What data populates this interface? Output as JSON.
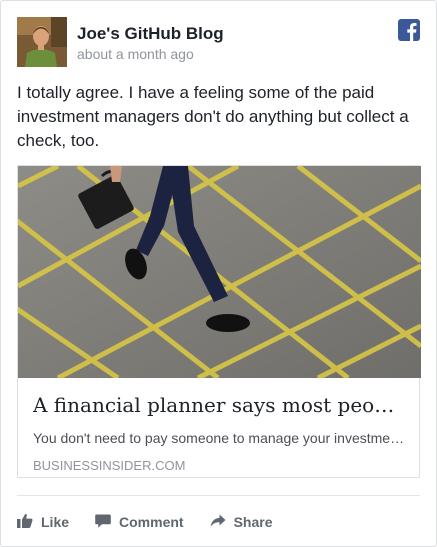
{
  "post": {
    "author": "Joe's GitHub Blog",
    "timestamp": "about a month ago",
    "text": "I totally agree. I have a feeling some of the paid investment managers don't do anything but collect a check, too."
  },
  "link_preview": {
    "title": "A financial planner says most people…",
    "description": "You don't need to pay someone to manage your investments…",
    "domain": "BUSINESSINSIDER.COM"
  },
  "actions": {
    "like_label": "Like",
    "comment_label": "Comment",
    "share_label": "Share"
  },
  "colors": {
    "facebook_blue": "#3b5998",
    "action_gray": "#606770"
  },
  "icons": {
    "brand": "facebook-icon",
    "like": "thumbs-up-icon",
    "comment": "comment-icon",
    "share": "share-icon"
  }
}
